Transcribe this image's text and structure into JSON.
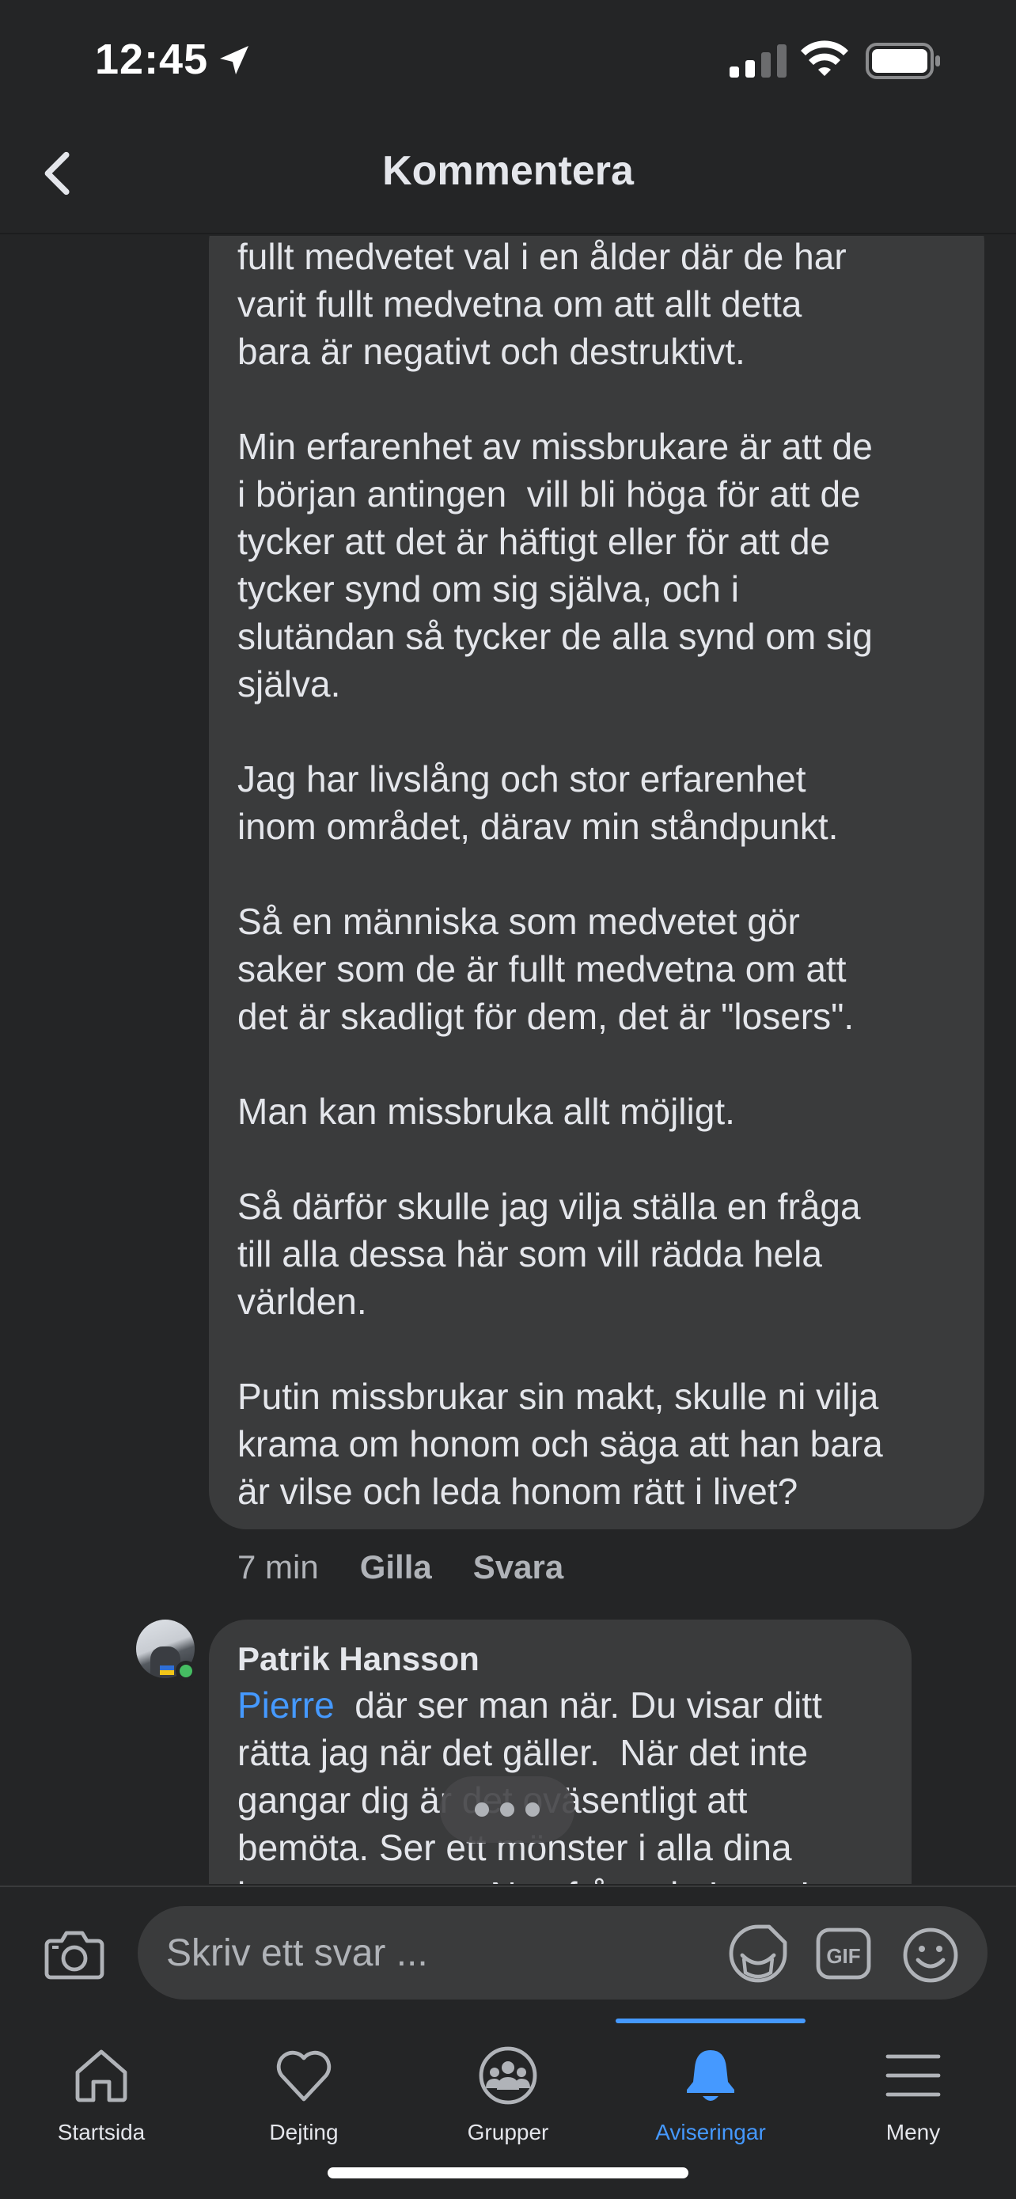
{
  "status_bar": {
    "time": "12:45"
  },
  "header": {
    "title": "Kommentera"
  },
  "comment": {
    "text": "fullt medvetet val i en ålder där de har\nvarit fullt medvetna om att allt detta\nbara är negativt och destruktivt.\n\nMin erfarenhet av missbrukare är att de\ni början antingen  vill bli höga för att de\ntycker att det är häftigt eller för att de\ntycker synd om sig själva, och i\nslutändan så tycker de alla synd om sig\nsjälva.\n\nJag har livslång och stor erfarenhet\ninom området, därav min ståndpunkt.\n\nSå en människa som medvetet gör\nsaker som de är fullt medvetna om att\ndet är skadligt för dem, det är \"losers\".\n\nMan kan missbruka allt möjligt.\n\nSå därför skulle jag vilja ställa en fråga\ntill alla dessa här som vill rädda hela\nvärlden.\n\nPutin missbrukar sin makt, skulle ni vilja\nkrama om honom och säga att han bara\när vilse och leda honom rätt i livet?",
    "time": "7 min",
    "like_label": "Gilla",
    "reply_label": "Svara"
  },
  "reply": {
    "author": "Patrik Hansson",
    "mention": "Pierre",
    "text": "  där ser man när. Du visar ditt\nrätta jag när det gäller.  När det inte\ngangar dig är det oväsentligt att\nbemöta. Ser ett mönster i alla dina\nkommentarer... Nog från mig Loser!"
  },
  "composer": {
    "placeholder": "Skriv ett svar ...",
    "gif_label": "GIF"
  },
  "tabs": [
    {
      "label": "Startsida",
      "icon": "home-icon",
      "active": false
    },
    {
      "label": "Dejting",
      "icon": "heart-icon",
      "active": false
    },
    {
      "label": "Grupper",
      "icon": "groups-icon",
      "active": false
    },
    {
      "label": "Aviseringar",
      "icon": "bell-icon",
      "active": true
    },
    {
      "label": "Meny",
      "icon": "menu-icon",
      "active": false
    }
  ],
  "colors": {
    "background": "#242526",
    "bubble": "#3a3b3c",
    "accent": "#4599ff",
    "online": "#45bd62"
  }
}
